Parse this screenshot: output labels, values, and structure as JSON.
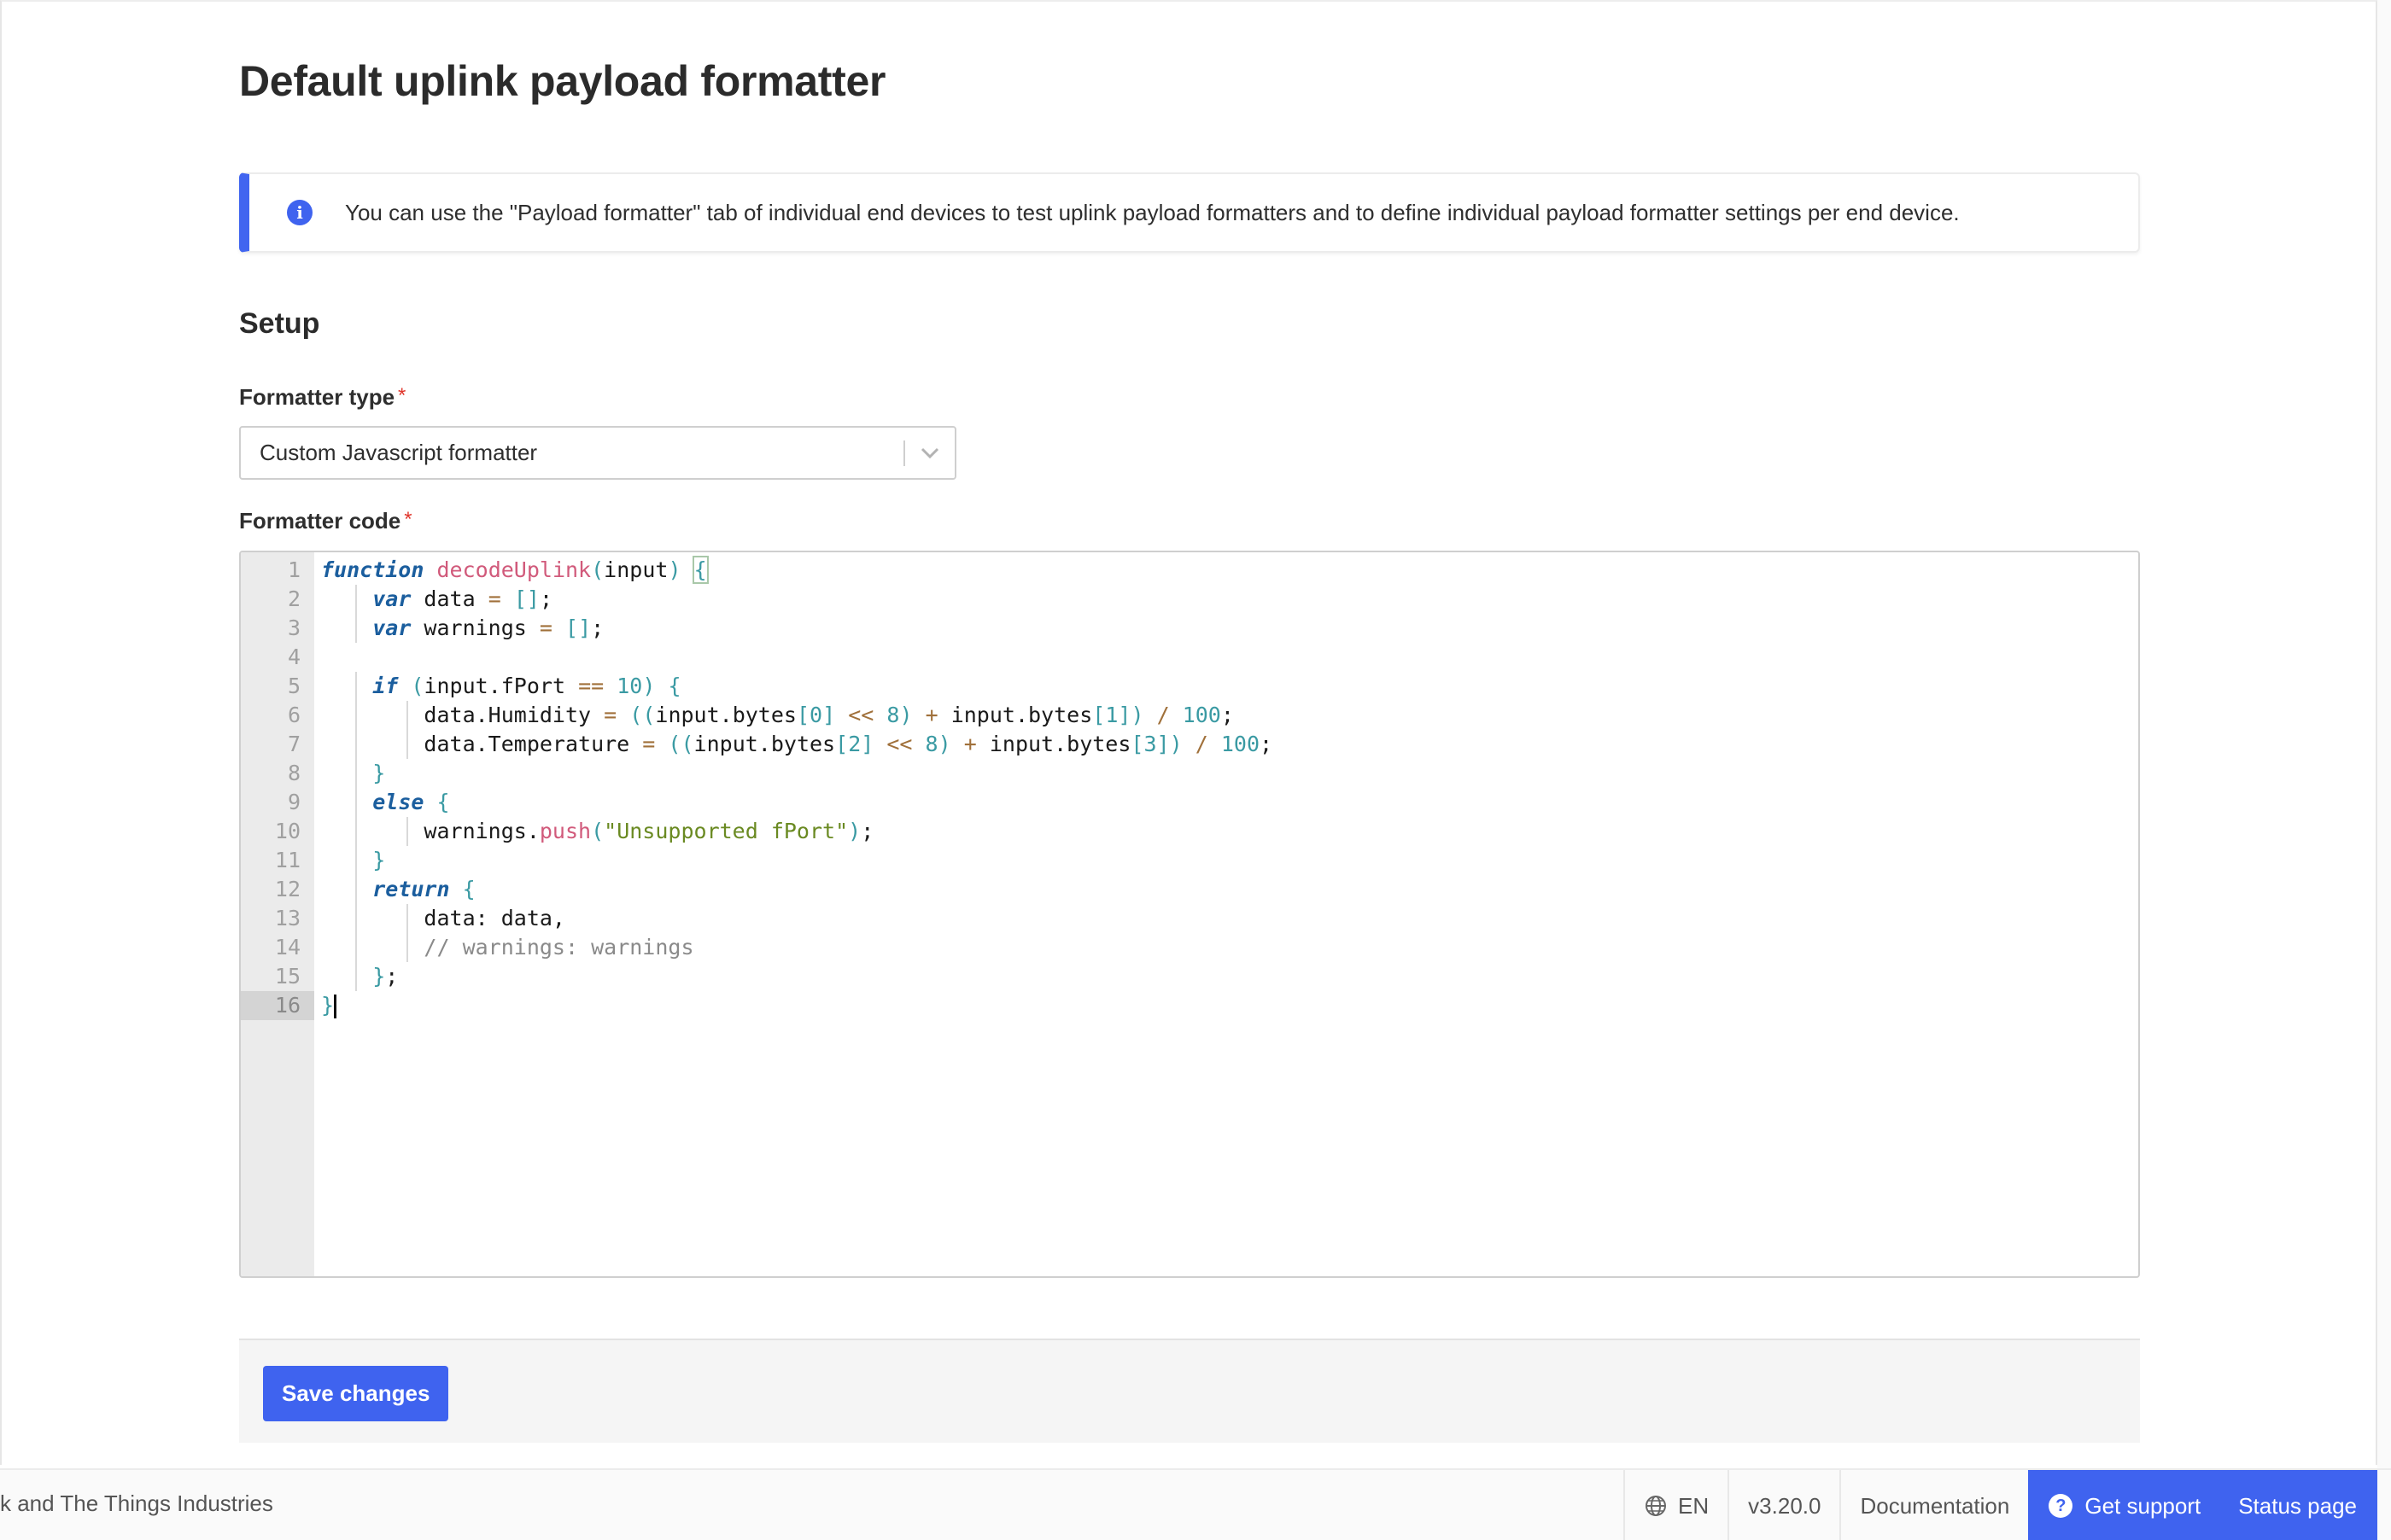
{
  "page": {
    "title": "Default uplink payload formatter"
  },
  "notice": {
    "text": "You can use the \"Payload formatter\" tab of individual end devices to test uplink payload formatters and to define individual payload formatter settings per end device."
  },
  "setup": {
    "section_title": "Setup",
    "formatter_type": {
      "label": "Formatter type",
      "required_mark": "*",
      "selected_value": "Custom Javascript formatter"
    },
    "formatter_code": {
      "label": "Formatter code",
      "required_mark": "*",
      "active_line": 16,
      "lines": [
        "function decodeUplink(input) {",
        "    var data = [];",
        "    var warnings = [];",
        "",
        "    if (input.fPort == 10) {",
        "        data.Humidity = ((input.bytes[0] << 8) + input.bytes[1]) / 100;",
        "        data.Temperature = ((input.bytes[2] << 8) + input.bytes[3]) / 100;",
        "    }",
        "    else {",
        "        warnings.push(\"Unsupported fPort\");",
        "    }",
        "    return {",
        "        data: data,",
        "        // warnings: warnings",
        "    };",
        "}"
      ]
    }
  },
  "actions": {
    "save_label": "Save changes"
  },
  "footer": {
    "copyright_fragment": "k and The Things Industries",
    "language": "EN",
    "version": "v3.20.0",
    "documentation": "Documentation",
    "support": "Get support",
    "status": "Status page"
  },
  "colors": {
    "accent": "#3f63ef",
    "required": "#e0362c",
    "keyword": "#1b5e9e",
    "function_name": "#d15a7b",
    "number": "#3a9aa3",
    "string": "#6a8a22",
    "comment": "#8a8a8a"
  },
  "icons": {
    "notice": "info-icon",
    "select": "chevron-down-icon",
    "language": "globe-icon",
    "support": "help-circle-icon"
  }
}
